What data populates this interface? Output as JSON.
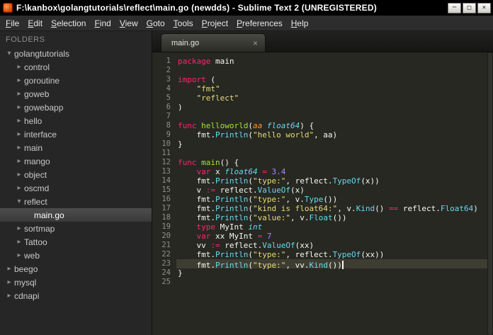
{
  "window": {
    "title": "F:\\kanbox\\golangtutorials\\reflect\\main.go (newdds) - Sublime Text 2 (UNREGISTERED)",
    "controls": {
      "minimize": "─",
      "maximize": "□",
      "close": "×"
    }
  },
  "menubar": {
    "items": [
      "File",
      "Edit",
      "Selection",
      "Find",
      "View",
      "Goto",
      "Tools",
      "Project",
      "Preferences",
      "Help"
    ]
  },
  "sidebar": {
    "header": "FOLDERS",
    "items": [
      {
        "label": "golangtutorials",
        "depth": 0,
        "kind": "folder",
        "expanded": true
      },
      {
        "label": "control",
        "depth": 1,
        "kind": "folder",
        "expanded": false
      },
      {
        "label": "goroutine",
        "depth": 1,
        "kind": "folder",
        "expanded": false
      },
      {
        "label": "goweb",
        "depth": 1,
        "kind": "folder",
        "expanded": false
      },
      {
        "label": "gowebapp",
        "depth": 1,
        "kind": "folder",
        "expanded": false
      },
      {
        "label": "hello",
        "depth": 1,
        "kind": "folder",
        "expanded": false
      },
      {
        "label": "interface",
        "depth": 1,
        "kind": "folder",
        "expanded": false
      },
      {
        "label": "main",
        "depth": 1,
        "kind": "folder",
        "expanded": false
      },
      {
        "label": "mango",
        "depth": 1,
        "kind": "folder",
        "expanded": false
      },
      {
        "label": "object",
        "depth": 1,
        "kind": "folder",
        "expanded": false
      },
      {
        "label": "oscmd",
        "depth": 1,
        "kind": "folder",
        "expanded": false
      },
      {
        "label": "reflect",
        "depth": 1,
        "kind": "folder",
        "expanded": true
      },
      {
        "label": "main.go",
        "depth": 2,
        "kind": "file",
        "selected": true
      },
      {
        "label": "sortmap",
        "depth": 1,
        "kind": "folder",
        "expanded": false
      },
      {
        "label": "Tattoo",
        "depth": 1,
        "kind": "folder",
        "expanded": false
      },
      {
        "label": "web",
        "depth": 1,
        "kind": "folder",
        "expanded": false
      },
      {
        "label": "beego",
        "depth": 0,
        "kind": "folder",
        "expanded": false
      },
      {
        "label": "mysql",
        "depth": 0,
        "kind": "folder",
        "expanded": false
      },
      {
        "label": "cdnapi",
        "depth": 0,
        "kind": "folder",
        "expanded": false
      }
    ]
  },
  "tab": {
    "label": "main.go",
    "close_glyph": "×"
  },
  "editor": {
    "language": "go",
    "current_line": 23,
    "lines": [
      [
        [
          "kw",
          "package"
        ],
        [
          "pl",
          " main"
        ]
      ],
      [],
      [
        [
          "kw",
          "import"
        ],
        [
          "pl",
          " ("
        ]
      ],
      [
        [
          "pl",
          "    "
        ],
        [
          "str",
          "\"fmt\""
        ]
      ],
      [
        [
          "pl",
          "    "
        ],
        [
          "str",
          "\"reflect\""
        ]
      ],
      [
        [
          "pl",
          ")"
        ]
      ],
      [],
      [
        [
          "kw",
          "func"
        ],
        [
          "fn",
          " helloworld"
        ],
        [
          "pl",
          "("
        ],
        [
          "pa",
          "aa"
        ],
        [
          "ty",
          " float64"
        ],
        [
          "pl",
          ") {"
        ]
      ],
      [
        [
          "pl",
          "    fmt."
        ],
        [
          "ca",
          "Println"
        ],
        [
          "pl",
          "("
        ],
        [
          "str",
          "\"hello world\""
        ],
        [
          "pl",
          ", aa)"
        ]
      ],
      [
        [
          "pl",
          "}"
        ]
      ],
      [],
      [
        [
          "kw",
          "func"
        ],
        [
          "fn",
          " main"
        ],
        [
          "pl",
          "() {"
        ]
      ],
      [
        [
          "pl",
          "    "
        ],
        [
          "kw",
          "var"
        ],
        [
          "pl",
          " x "
        ],
        [
          "ty",
          "float64"
        ],
        [
          "pl",
          " "
        ],
        [
          "op",
          "="
        ],
        [
          "pl",
          " "
        ],
        [
          "num",
          "3.4"
        ]
      ],
      [
        [
          "pl",
          "    fmt."
        ],
        [
          "ca",
          "Println"
        ],
        [
          "pl",
          "("
        ],
        [
          "str",
          "\"type:\""
        ],
        [
          "pl",
          ", reflect."
        ],
        [
          "ca",
          "TypeOf"
        ],
        [
          "pl",
          "(x))"
        ]
      ],
      [
        [
          "pl",
          "    v "
        ],
        [
          "op",
          ":="
        ],
        [
          "pl",
          " reflect."
        ],
        [
          "ca",
          "ValueOf"
        ],
        [
          "pl",
          "(x)"
        ]
      ],
      [
        [
          "pl",
          "    fmt."
        ],
        [
          "ca",
          "Println"
        ],
        [
          "pl",
          "("
        ],
        [
          "str",
          "\"type:\""
        ],
        [
          "pl",
          ", v."
        ],
        [
          "ca",
          "Type"
        ],
        [
          "pl",
          "())"
        ]
      ],
      [
        [
          "pl",
          "    fmt."
        ],
        [
          "ca",
          "Println"
        ],
        [
          "pl",
          "("
        ],
        [
          "str",
          "\"kind is float64:\""
        ],
        [
          "pl",
          ", v."
        ],
        [
          "ca",
          "Kind"
        ],
        [
          "pl",
          "() "
        ],
        [
          "op",
          "=="
        ],
        [
          "pl",
          " reflect."
        ],
        [
          "ca",
          "Float64"
        ],
        [
          "pl",
          ")"
        ]
      ],
      [
        [
          "pl",
          "    fmt."
        ],
        [
          "ca",
          "Println"
        ],
        [
          "pl",
          "("
        ],
        [
          "str",
          "\"value:\""
        ],
        [
          "pl",
          ", v."
        ],
        [
          "ca",
          "Float"
        ],
        [
          "pl",
          "())"
        ]
      ],
      [
        [
          "pl",
          "    "
        ],
        [
          "kw",
          "type"
        ],
        [
          "pl",
          " MyInt "
        ],
        [
          "ty",
          "int"
        ]
      ],
      [
        [
          "pl",
          "    "
        ],
        [
          "kw",
          "var"
        ],
        [
          "pl",
          " xx MyInt "
        ],
        [
          "op",
          "="
        ],
        [
          "pl",
          " "
        ],
        [
          "num",
          "7"
        ]
      ],
      [
        [
          "pl",
          "    vv "
        ],
        [
          "op",
          ":="
        ],
        [
          "pl",
          " reflect."
        ],
        [
          "ca",
          "ValueOf"
        ],
        [
          "pl",
          "(xx)"
        ]
      ],
      [
        [
          "pl",
          "    fmt."
        ],
        [
          "ca",
          "Println"
        ],
        [
          "pl",
          "("
        ],
        [
          "str",
          "\"type:\""
        ],
        [
          "pl",
          ", reflect."
        ],
        [
          "ca",
          "TypeOf"
        ],
        [
          "pl",
          "(xx))"
        ]
      ],
      [
        [
          "pl",
          "    fmt."
        ],
        [
          "ca",
          "Println"
        ],
        [
          "pl",
          "("
        ],
        [
          "str",
          "\"type:\""
        ],
        [
          "pl",
          ", vv."
        ],
        [
          "ca",
          "Kind"
        ],
        [
          "pl",
          "())"
        ],
        [
          "cur",
          ""
        ]
      ],
      [
        [
          "pl",
          "}"
        ]
      ],
      []
    ]
  },
  "colors": {
    "titlebar_bg": "#000000",
    "menubar_bg": "#2d2d2d",
    "sidebar_bg": "#262626",
    "editor_bg": "#272822",
    "current_line_bg": "#3e3d32",
    "keyword": "#f92672",
    "string": "#e6db74",
    "number": "#ae81ff",
    "function_name": "#a6e22e",
    "type_italic": "#66d9ef",
    "call": "#66d9ef",
    "param": "#fd971f",
    "line_number": "#8f908a",
    "plain_text": "#f8f8f2"
  }
}
